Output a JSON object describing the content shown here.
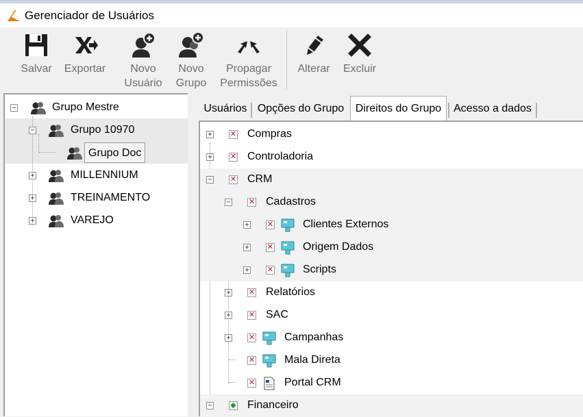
{
  "window": {
    "title": "Gerenciador de Usuários",
    "accent": "#f0a020"
  },
  "toolbar": {
    "salvar": "Salvar",
    "exportar": "Exportar",
    "novo_usuario_1": "Novo",
    "novo_usuario_2": "Usuário",
    "novo_grupo_1": "Novo",
    "novo_grupo_2": "Grupo",
    "propagar_1": "Propagar",
    "propagar_2": "Permissões",
    "alterar": "Alterar",
    "excluir": "Excluir"
  },
  "group_tree": {
    "items": [
      {
        "label": "Grupo Mestre",
        "expander": "−"
      },
      {
        "label": "Grupo 10970",
        "expander": "−"
      },
      {
        "label": "Grupo Doc",
        "selected": true
      },
      {
        "label": "MILLENNIUM",
        "expander": "+"
      },
      {
        "label": "TREINAMENTO",
        "expander": "+"
      },
      {
        "label": "VAREJO",
        "expander": "+"
      }
    ]
  },
  "tabs": {
    "usuarios": "Usuários",
    "opcoes": "Opções do Grupo",
    "direitos": "Direitos do Grupo",
    "acesso": "Acesso a dados",
    "active": "Direitos do Grupo"
  },
  "rights_tree": {
    "items": [
      {
        "label": "Compras",
        "expander": "+",
        "state": "x"
      },
      {
        "label": "Controladoria",
        "expander": "+",
        "state": "x"
      },
      {
        "label": "CRM",
        "expander": "−",
        "state": "x"
      },
      {
        "label": "Cadastros",
        "expander": "−",
        "state": "x"
      },
      {
        "label": "Clientes Externos",
        "expander": "+",
        "state": "x",
        "icon": "module-icon"
      },
      {
        "label": "Origem Dados",
        "expander": "+",
        "state": "x",
        "icon": "module-icon"
      },
      {
        "label": "Scripts",
        "expander": "+",
        "state": "x",
        "icon": "module-icon"
      },
      {
        "label": "Relatórios",
        "expander": "+",
        "state": "x"
      },
      {
        "label": "SAC",
        "expander": "+",
        "state": "x"
      },
      {
        "label": "Campanhas",
        "expander": "+",
        "state": "x",
        "icon": "module-icon"
      },
      {
        "label": "Mala Direta",
        "state": "x",
        "icon": "module-icon"
      },
      {
        "label": "Portal CRM",
        "state": "x",
        "icon": "document-icon"
      },
      {
        "label": "Financeiro",
        "expander": "−",
        "state": "partial"
      }
    ],
    "deny_color": "#c0182b",
    "partial_color": "#2a9a2a"
  }
}
